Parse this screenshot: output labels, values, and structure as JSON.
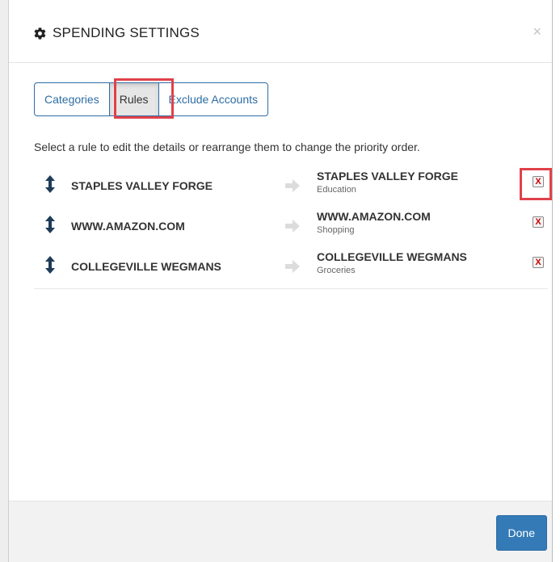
{
  "modal": {
    "title": "SPENDING SETTINGS",
    "close_label": "×"
  },
  "tabs": [
    {
      "label": "Categories",
      "active": false
    },
    {
      "label": "Rules",
      "active": true
    },
    {
      "label": "Exclude Accounts",
      "active": false
    }
  ],
  "instructions": "Select a rule to edit the details or rearrange them to change the priority order.",
  "rules": [
    {
      "source": "STAPLES VALLEY FORGE",
      "dest_name": "STAPLES VALLEY FORGE",
      "dest_category": "Education",
      "delete_label": "X"
    },
    {
      "source": "WWW.AMAZON.COM",
      "dest_name": "WWW.AMAZON.COM",
      "dest_category": "Shopping",
      "delete_label": "X"
    },
    {
      "source": "COLLEGEVILLE WEGMANS",
      "dest_name": "COLLEGEVILLE WEGMANS",
      "dest_category": "Groceries",
      "delete_label": "X"
    }
  ],
  "footer": {
    "done_label": "Done"
  },
  "icons": {
    "header": "gear-icon",
    "drag": "up-down-arrow-icon",
    "mapping": "arrow-right-icon",
    "delete": "red-x-icon"
  },
  "colors": {
    "primary": "#337ab7",
    "highlight": "#e0414a",
    "drag_icon": "#1f3b57",
    "delete": "#cc0000"
  }
}
